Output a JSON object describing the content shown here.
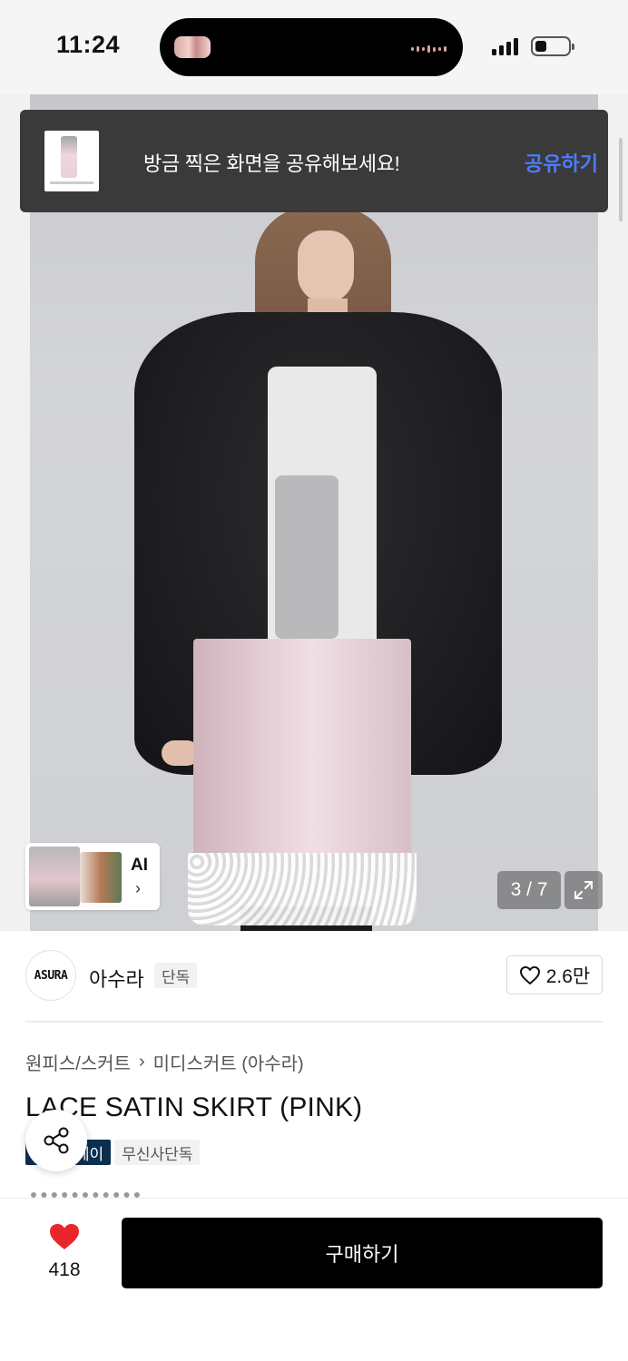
{
  "status_bar": {
    "time": "11:24"
  },
  "toast": {
    "message": "방금 찍은 화면을 공유해보세요!",
    "action": "공유하기"
  },
  "gallery": {
    "counter": "3 / 7",
    "ai_label": "AI",
    "ai_chevron": "›"
  },
  "brand": {
    "logo_text": "ASURA",
    "name": "아수라",
    "badge": "단독",
    "likes": "2.6만"
  },
  "product": {
    "breadcrumb": [
      "원피스/스커트",
      "미디스커트 (아수라)"
    ],
    "breadcrumb_separator": "›",
    "title": "LACE SATIN SKIRT (PINK)",
    "tags": [
      {
        "label": "무신사페이",
        "style": "dark"
      },
      {
        "label": "무신사단독",
        "style": "light"
      }
    ]
  },
  "bottom_bar": {
    "wish_count": "418",
    "buy_label": "구매하기"
  },
  "colors": {
    "accent_blue": "#4b7cff",
    "heart_red": "#e8262b",
    "toast_bg": "#3a3a3b",
    "buy_button": "#000000",
    "tag_dark": "#0d2f4f"
  },
  "icons": [
    "heart-outline-icon",
    "heart-filled-icon",
    "share-icon",
    "expand-icon",
    "chevron-right-icon",
    "signal-icon",
    "battery-icon"
  ]
}
